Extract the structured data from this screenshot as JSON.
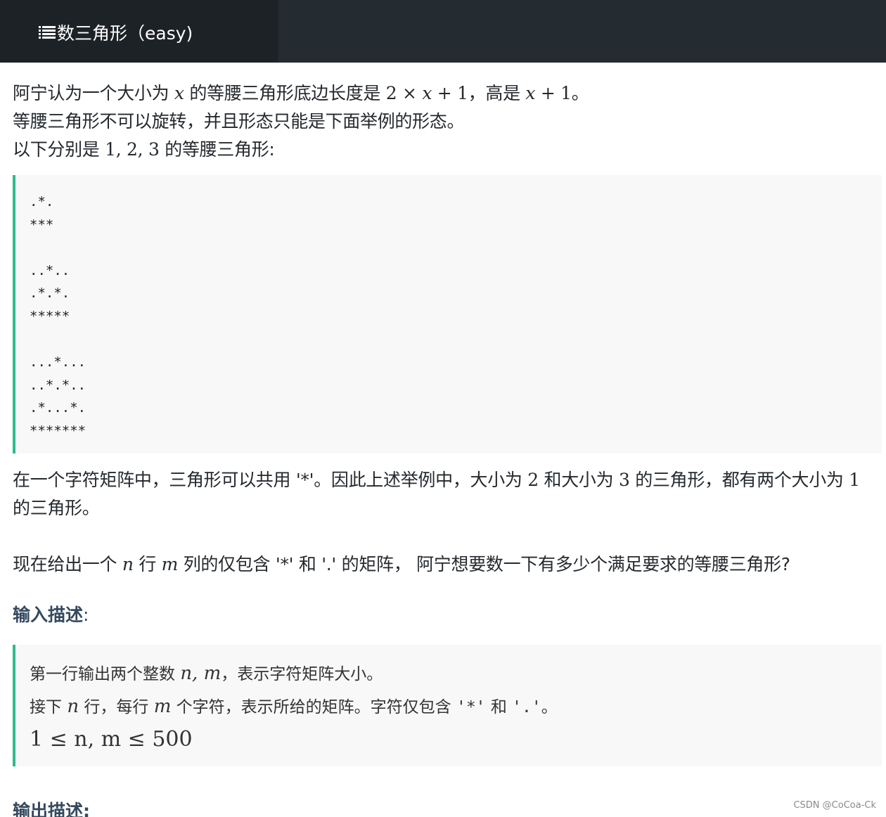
{
  "header": {
    "title": "数三角形（easy)"
  },
  "problem": {
    "p1_a": "阿宁认为一个大小为 ",
    "p1_x": "x",
    "p1_b": " 的等腰三角形底边长度是 ",
    "p1_expr_a": "2 × ",
    "p1_expr_x": "x",
    "p1_expr_b": " + 1",
    "p1_c": "，高是 ",
    "p1_expr2_x": "x",
    "p1_expr2_b": " + 1",
    "p1_d": "。",
    "p2": "等腰三角形不可以旋转，并且形态只能是下面举例的形态。",
    "p3_a": "以下分别是 ",
    "p3_nums": "1, 2, 3",
    "p3_b": " 的等腰三角形:",
    "example": ".*.\n***\n\n..*..\n.*.*.\n*****\n\n...*...\n..*.*..\n.*...*.\n*******",
    "p4_a": "在一个字符矩阵中，三角形可以共用 '*'。因此上述举例中，大小为 ",
    "p4_n2": "2",
    "p4_b": " 和大小为 ",
    "p4_n3": "3",
    "p4_c": " 的三角形，都有两个大小为 ",
    "p4_n1": "1",
    "p5": "的三角形。",
    "p6_a": "现在给出一个 ",
    "p6_n": "n",
    "p6_b": " 行 ",
    "p6_m": "m",
    "p6_c": " 列的仅包含 '*' 和 '.' 的矩阵， 阿宁想要数一下有多少个满足要求的等腰三角形?"
  },
  "input_section": {
    "heading": "输入描述",
    "colon": ":",
    "l1_a": "第一行输出两个整数 ",
    "l1_vars": "n, m",
    "l1_b": "，表示字符矩阵大小。",
    "l2_a": "接下 ",
    "l2_n": "n",
    "l2_b": " 行，每行 ",
    "l2_m": "m",
    "l2_c": " 个字符，表示所给的矩阵。字符仅包含 ",
    "l2_star": "'*'",
    "l2_d": " 和 ",
    "l2_dot": "'.'",
    "l2_e": "。",
    "l3": "1 ≤ n, m ≤ 500"
  },
  "output_section": {
    "heading": "输出描述:"
  },
  "watermark": "CSDN @CoCoa-Ck"
}
